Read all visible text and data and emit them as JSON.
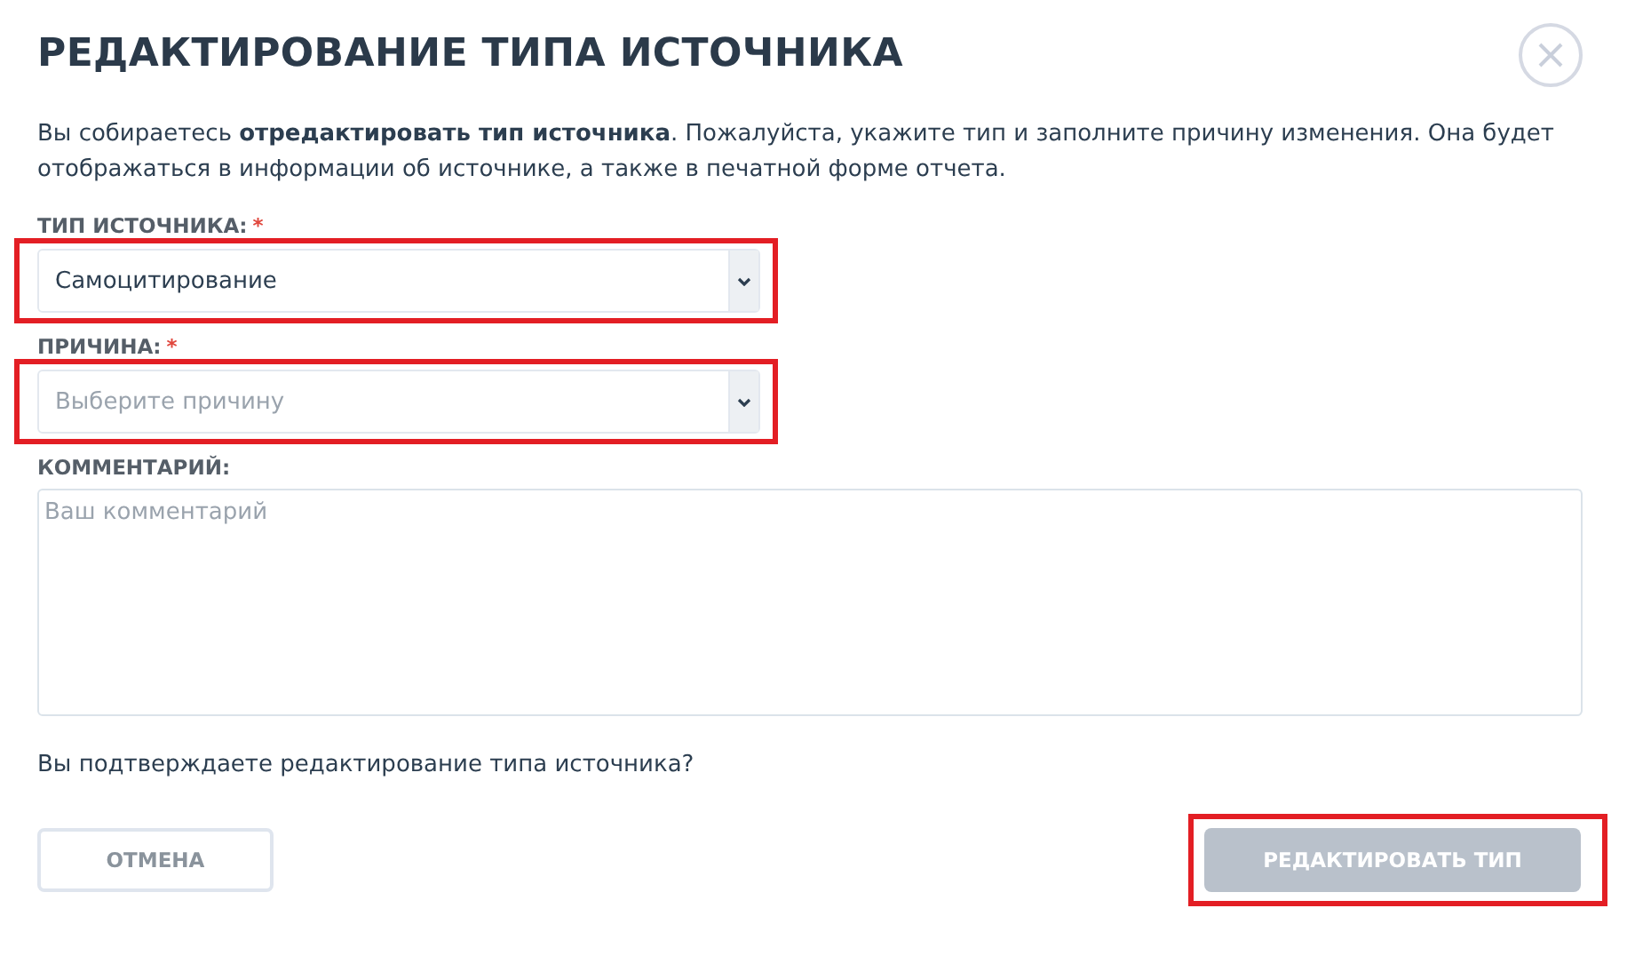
{
  "dialog": {
    "title": "РЕДАКТИРОВАНИЕ ТИПА ИСТОЧНИКА",
    "intro": "Вы собираетесь **отредактировать тип источника**. Пожалуйста, укажите тип и заполните причину изменения. Она будет отображаться в информации об источнике, а также в печатной форме отчета."
  },
  "fields": [
    {
      "kind": "select",
      "label": "ТИП ИСТОЧНИКА:",
      "required_mark": "*",
      "highlighted": true,
      "value": "Самоцитирование"
    },
    {
      "kind": "select",
      "label": "ПРИЧИНА:",
      "required_mark": "*",
      "highlighted": true,
      "placeholder": "Выберите причину"
    },
    {
      "kind": "textarea",
      "label": "КОММЕНТАРИЙ:",
      "placeholder": "Ваш комментарий"
    }
  ],
  "question": "Вы подтверждаете редактирование типа источника?",
  "buttons": [
    {
      "kind": "secondary",
      "label": "ОТМЕНА",
      "disabled": false,
      "highlighted": false
    },
    {
      "kind": "primary",
      "label": "РЕДАКТИРОВАТЬ ТИП",
      "disabled": true,
      "highlighted": true
    }
  ]
}
